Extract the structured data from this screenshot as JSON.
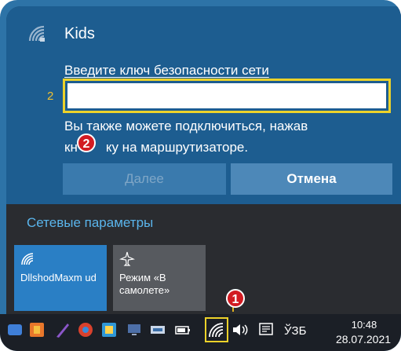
{
  "wifi_flyout": {
    "network_name": "Kids",
    "prompt": "Введите ключ безопасности сети",
    "step_number": "2",
    "key_input": {
      "value": "",
      "placeholder": ""
    },
    "help_line_1": "Вы также можете подключиться, нажав",
    "help_line_2_prefix": "кн",
    "help_line_2_suffix": "ку на маршрутизаторе.",
    "next_button": "Далее",
    "cancel_button": "Отмена"
  },
  "network_settings_label": "Сетевые параметры",
  "quick_actions": [
    {
      "label": "DllshodMaxm ud",
      "icon": "wifi-icon",
      "active": true
    },
    {
      "label": "Режим «В самолете»",
      "icon": "airplane-icon",
      "active": false
    }
  ],
  "annotations": {
    "badge_1": "1",
    "badge_2": "2"
  },
  "taskbar": {
    "icons": [
      "start-icon",
      "office-icon",
      "pen-icon",
      "browser-icon",
      "app-icon",
      "monitor-icon",
      "battery-icon",
      "wifi-icon",
      "volume-icon",
      "notification-icon"
    ],
    "language": "ЎЗБ",
    "time": "10:48",
    "date": "28.07.2021"
  },
  "colors": {
    "accent_yellow": "#ecd22a",
    "flyout_blue": "#1d5d90",
    "badge_red": "#d21b22",
    "link_blue": "#5ab5ec"
  }
}
